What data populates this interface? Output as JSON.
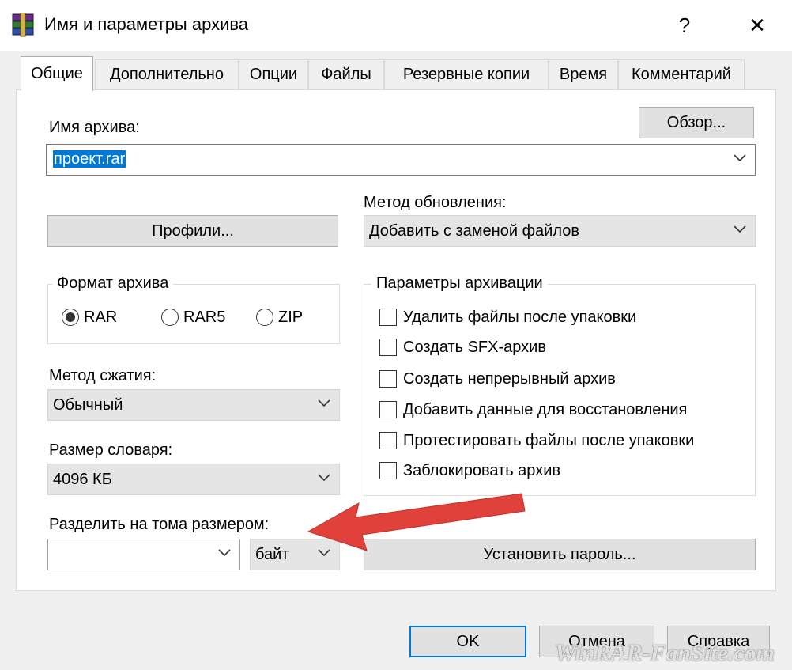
{
  "window": {
    "title": "Имя и параметры архива",
    "help": "?",
    "close": "✕"
  },
  "tabs": [
    "Общие",
    "Дополнительно",
    "Опции",
    "Файлы",
    "Резервные копии",
    "Время",
    "Комментарий"
  ],
  "archive_name": {
    "label": "Имя архива:",
    "browse": "Обзор...",
    "value": "проект.rar"
  },
  "profiles_button": "Профили...",
  "update_method": {
    "label": "Метод обновления:",
    "value": "Добавить с заменой файлов"
  },
  "archive_format": {
    "title": "Формат архива",
    "options": [
      "RAR",
      "RAR5",
      "ZIP"
    ],
    "selected": "RAR"
  },
  "compression_method": {
    "label": "Метод сжатия:",
    "value": "Обычный"
  },
  "dictionary_size": {
    "label": "Размер словаря:",
    "value": "4096 КБ"
  },
  "split_volumes": {
    "label": "Разделить на тома размером:",
    "value": "",
    "unit": "байт"
  },
  "archiving_options": {
    "title": "Параметры архивации",
    "items": [
      {
        "label": "Удалить файлы после упаковки",
        "checked": false
      },
      {
        "label": "Создать SFX-архив",
        "checked": false
      },
      {
        "label": "Создать непрерывный архив",
        "checked": false
      },
      {
        "label": "Добавить данные для восстановления",
        "checked": false
      },
      {
        "label": "Протестировать файлы после упаковки",
        "checked": false
      },
      {
        "label": "Заблокировать архив",
        "checked": false
      }
    ]
  },
  "set_password_button": "Установить пароль...",
  "footer": {
    "ok": "OK",
    "cancel": "Отмена",
    "help": "Справка"
  },
  "watermark": "WinRAR-FanSite.com",
  "colors": {
    "selection": "#0078d7",
    "ok_border": "#0078d7",
    "arrow": "#e0413a"
  }
}
